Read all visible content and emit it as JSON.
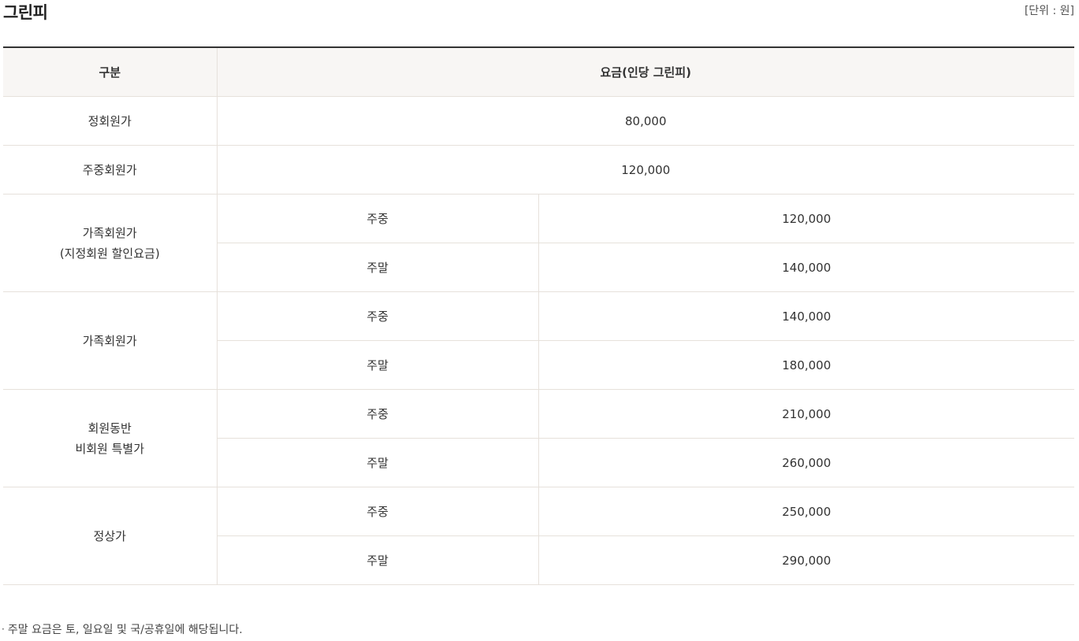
{
  "title": "그린피",
  "unit": "[단위 : 원]",
  "table": {
    "header": {
      "category": "구분",
      "fee": "요금(인당 그린피)"
    },
    "simple_rows": [
      {
        "category": "정회원가",
        "value": "80,000"
      },
      {
        "category": "주중회원가",
        "value": "120,000"
      }
    ],
    "groups": [
      {
        "category_line1": "가족회원가",
        "category_line2": "(지정회원 할인요금)",
        "rows": [
          {
            "day": "주중",
            "value": "120,000"
          },
          {
            "day": "주말",
            "value": "140,000"
          }
        ]
      },
      {
        "category_line1": "가족회원가",
        "category_line2": "",
        "rows": [
          {
            "day": "주중",
            "value": "140,000"
          },
          {
            "day": "주말",
            "value": "180,000"
          }
        ]
      },
      {
        "category_line1": "회원동반",
        "category_line2": "비회원 특별가",
        "rows": [
          {
            "day": "주중",
            "value": "210,000"
          },
          {
            "day": "주말",
            "value": "260,000"
          }
        ]
      },
      {
        "category_line1": "정상가",
        "category_line2": "",
        "rows": [
          {
            "day": "주중",
            "value": "250,000"
          },
          {
            "day": "주말",
            "value": "290,000"
          }
        ]
      }
    ]
  },
  "footnote": {
    "bullet": "·",
    "text": "주말 요금은 토, 일요일 및 국/공휴일에 해당됩니다."
  }
}
